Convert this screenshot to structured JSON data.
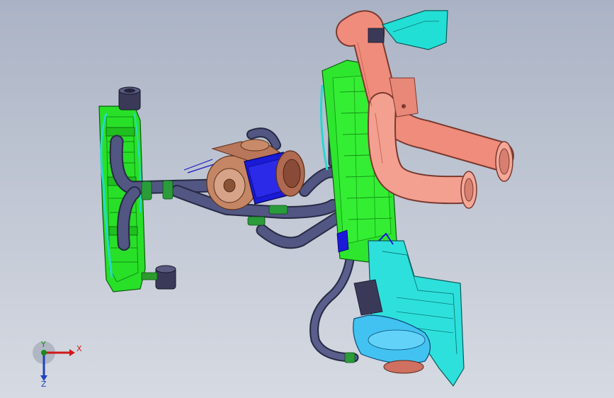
{
  "viewport": {
    "background_top": "#aab3c5",
    "background_bottom": "#d6dae2"
  },
  "model": {
    "components": [
      {
        "name": "radiator-tank",
        "color": "#22e022"
      },
      {
        "name": "radiator-cap",
        "color": "#3a3a55"
      },
      {
        "name": "coolant-hoses",
        "color": "#4a4e78"
      },
      {
        "name": "electric-motor",
        "color": "#1818d0"
      },
      {
        "name": "pump-housing",
        "color": "#c88a68"
      },
      {
        "name": "intercooler",
        "color": "#2ee82e"
      },
      {
        "name": "charge-air-pipe",
        "color": "#f08c7c"
      },
      {
        "name": "expansion-bracket",
        "color": "#22e0d8"
      },
      {
        "name": "reservoir-tank",
        "color": "#40c0f0"
      }
    ]
  },
  "triad": {
    "x_label": "X",
    "y_label": "Y",
    "z_label": "Z",
    "x_color": "#d01818",
    "y_color": "#1a8a1a",
    "z_color": "#2040c0"
  }
}
